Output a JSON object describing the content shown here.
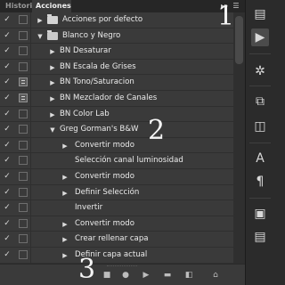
{
  "tabs": {
    "history": "Historia",
    "actions": "Acciones"
  },
  "panel_menu_icon": "panel-menu-icon",
  "rows": [
    {
      "label": "Acciones por defecto",
      "indent": 0,
      "expanded": false,
      "kind": "set",
      "dialog": false
    },
    {
      "label": "Blanco y Negro",
      "indent": 0,
      "expanded": true,
      "kind": "set",
      "dialog": false
    },
    {
      "label": "BN Desaturar",
      "indent": 1,
      "expanded": false,
      "kind": "action",
      "dialog": false
    },
    {
      "label": "BN Escala de Grises",
      "indent": 1,
      "expanded": false,
      "kind": "action",
      "dialog": false
    },
    {
      "label": "BN Tono/Saturacion",
      "indent": 1,
      "expanded": false,
      "kind": "action",
      "dialog": true
    },
    {
      "label": "BN Mezclador de Canales",
      "indent": 1,
      "expanded": false,
      "kind": "action",
      "dialog": true
    },
    {
      "label": "BN Color Lab",
      "indent": 1,
      "expanded": false,
      "kind": "action",
      "dialog": false
    },
    {
      "label": "Greg Gorman's B&W",
      "indent": 1,
      "expanded": true,
      "kind": "action",
      "dialog": false
    },
    {
      "label": "Convertir modo",
      "indent": 2,
      "expanded": false,
      "kind": "step",
      "dialog": false
    },
    {
      "label": "Selección canal luminosidad",
      "indent": 2,
      "expanded": null,
      "kind": "step",
      "dialog": false
    },
    {
      "label": "Convertir modo",
      "indent": 2,
      "expanded": false,
      "kind": "step",
      "dialog": false
    },
    {
      "label": "Definir Selección",
      "indent": 2,
      "expanded": false,
      "kind": "step",
      "dialog": false
    },
    {
      "label": "Invertir",
      "indent": 2,
      "expanded": null,
      "kind": "step",
      "dialog": false
    },
    {
      "label": "Convertir modo",
      "indent": 2,
      "expanded": false,
      "kind": "step",
      "dialog": false
    },
    {
      "label": "Crear rellenar capa",
      "indent": 2,
      "expanded": false,
      "kind": "step",
      "dialog": false
    },
    {
      "label": "Definir capa actual",
      "indent": 2,
      "expanded": false,
      "kind": "step",
      "dialog": false
    }
  ],
  "annotations": {
    "one": "1",
    "two": "2",
    "three": "3"
  },
  "footer_buttons": [
    "stop-icon",
    "record-icon",
    "play-icon",
    "new-set-icon",
    "new-action-icon",
    "delete-icon"
  ],
  "dock_tools": [
    "history-icon",
    "actions-play-icon",
    "navigator-icon",
    "3d-icon",
    "adjust-icon",
    "character-icon",
    "paragraph-icon",
    "properties-icon",
    "notes-icon"
  ],
  "colors": {
    "panel": "#3a3a3a",
    "tabbar": "#262626",
    "dock": "#2b2b2b",
    "text": "#ececec"
  }
}
